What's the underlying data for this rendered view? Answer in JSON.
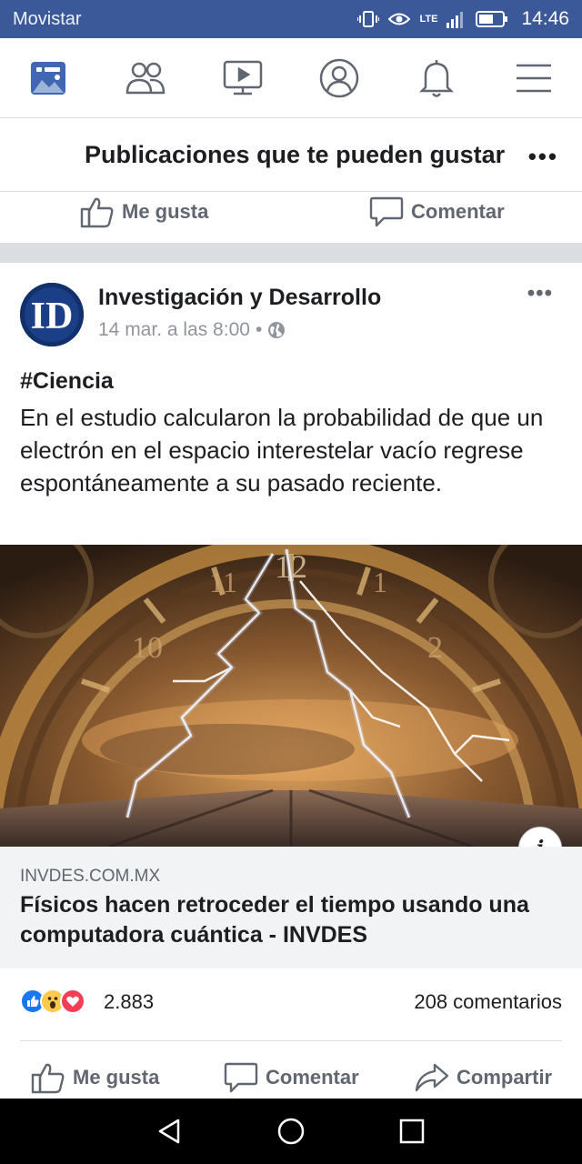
{
  "status_bar": {
    "carrier": "Movistar",
    "network": "LTE",
    "time": "14:46"
  },
  "nav": {
    "items": [
      "news-feed-icon",
      "friends-icon",
      "watch-icon",
      "profile-icon",
      "notifications-icon",
      "menu-icon"
    ],
    "active_color": "#4267b2",
    "icon_color": "#606770"
  },
  "section": {
    "title": "Publicaciones que te pueden gustar",
    "more": "•••"
  },
  "previous_post_actions": {
    "like": "Me gusta",
    "comment": "Comentar"
  },
  "post": {
    "author": "Investigación y Desarrollo",
    "avatar_text": "ID",
    "timestamp": "14 mar. a las 8:00",
    "separator": "•",
    "privacy": "globe-icon",
    "more": "•••",
    "hashtag": "#Ciencia",
    "text": "En el estudio calcularon la probabilidad de que un electrón en el espacio interestelar vacío regrese espontáneamente a su pasado reciente.",
    "image_info": "i",
    "link": {
      "domain": "INVDES.COM.MX",
      "title": "Físicos hacen retroceder el tiempo usando una computadora cuántica - INVDES"
    },
    "reactions": {
      "types": [
        "like",
        "wow",
        "love"
      ],
      "count": "2.883"
    },
    "comments": "208 comentarios",
    "actions": {
      "like": "Me gusta",
      "comment": "Comentar",
      "share": "Compartir"
    }
  },
  "colors": {
    "brand": "#3b5998",
    "like_blue": "#1877f2",
    "love_red": "#f33e58",
    "wow_yellow": "#fcc94f"
  }
}
